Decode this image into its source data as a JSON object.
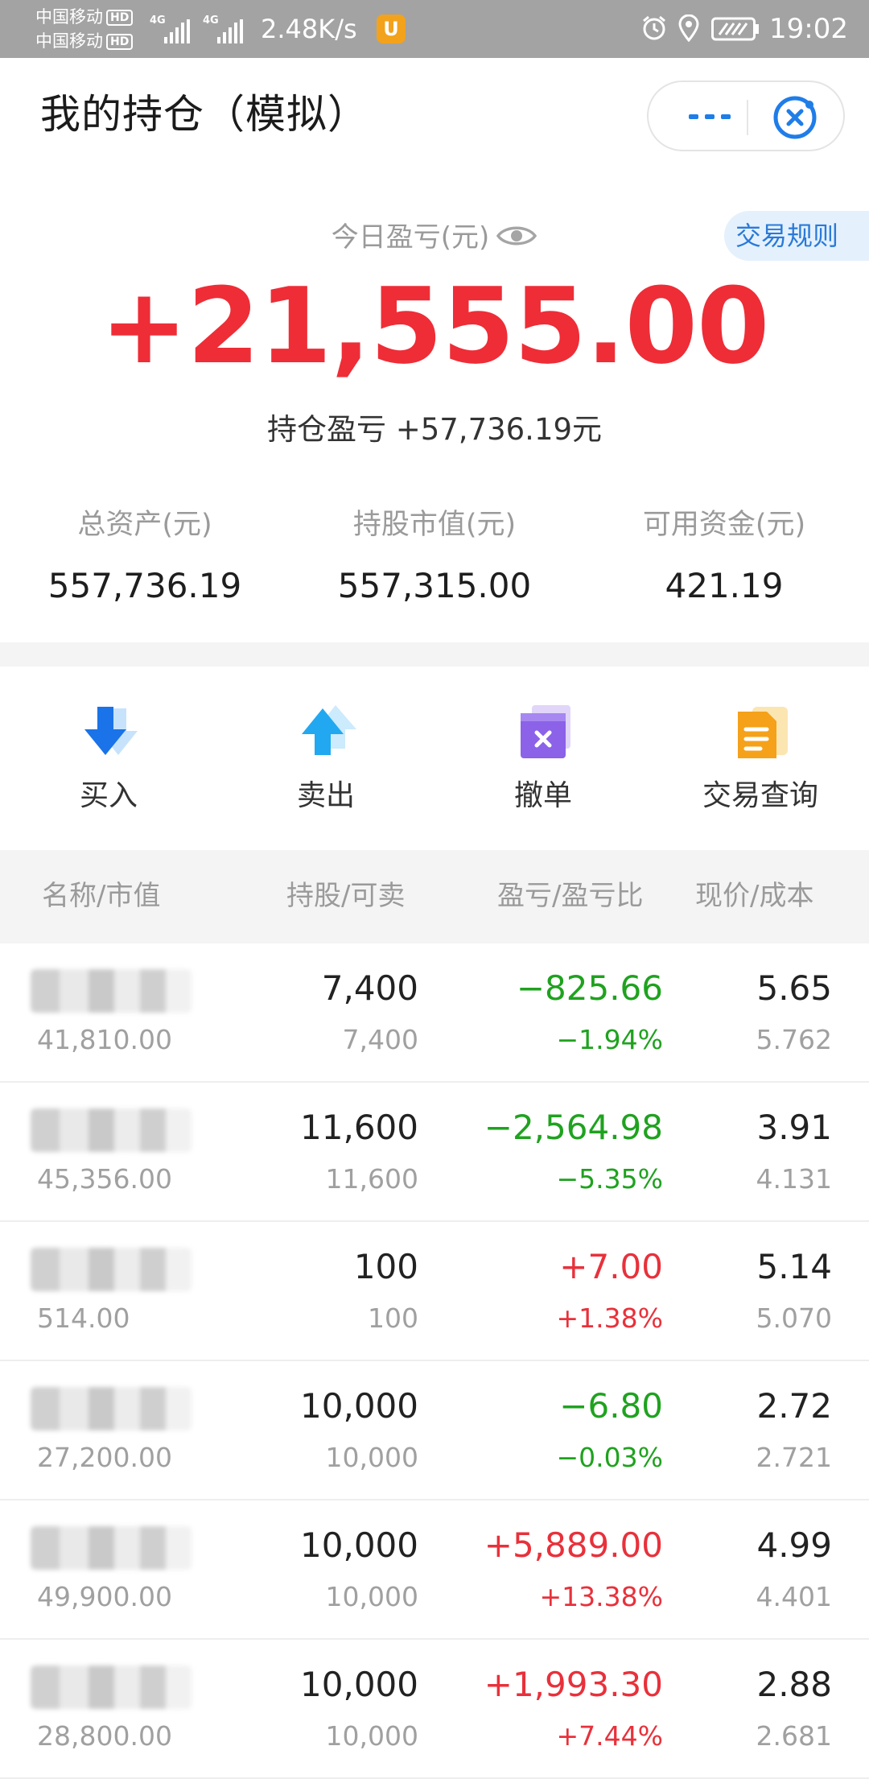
{
  "status_bar": {
    "carrier1": "中国移动",
    "carrier2": "中国移动",
    "hd": "HD",
    "net1": "4G",
    "net2": "4G",
    "speed": "2.48K/s",
    "app_badge": "U",
    "time": "19:02"
  },
  "header": {
    "title": "我的持仓（模拟）"
  },
  "summary": {
    "rules_label": "交易规则",
    "today_label": "今日盈亏(元)",
    "today_value": "+21,555.00",
    "hold_label": "持仓盈亏",
    "hold_value": "+57,736.19元",
    "assets": [
      {
        "label": "总资产(元)",
        "value": "557,736.19"
      },
      {
        "label": "持股市值(元)",
        "value": "557,315.00"
      },
      {
        "label": "可用资金(元)",
        "value": "421.19"
      }
    ]
  },
  "actions": [
    {
      "label": "买入",
      "icon": "buy-arrow-down-icon",
      "color": "#1a73e8"
    },
    {
      "label": "卖出",
      "icon": "sell-arrow-up-icon",
      "color": "#22a8f0"
    },
    {
      "label": "撤单",
      "icon": "cancel-order-icon",
      "color": "#8b62e8"
    },
    {
      "label": "交易查询",
      "icon": "trade-query-icon",
      "color": "#f5a11a"
    }
  ],
  "table": {
    "headers": [
      "名称/市值",
      "持股/可卖",
      "盈亏/盈亏比",
      "现价/成本"
    ],
    "rows": [
      {
        "market_value": "41,810.00",
        "qty": "7,400",
        "avail": "7,400",
        "pl": "−825.66",
        "pl_pct": "−1.94%",
        "price": "5.65",
        "cost": "5.762",
        "trend": "neg"
      },
      {
        "market_value": "45,356.00",
        "qty": "11,600",
        "avail": "11,600",
        "pl": "−2,564.98",
        "pl_pct": "−5.35%",
        "price": "3.91",
        "cost": "4.131",
        "trend": "neg"
      },
      {
        "market_value": "514.00",
        "qty": "100",
        "avail": "100",
        "pl": "+7.00",
        "pl_pct": "+1.38%",
        "price": "5.14",
        "cost": "5.070",
        "trend": "pos"
      },
      {
        "market_value": "27,200.00",
        "qty": "10,000",
        "avail": "10,000",
        "pl": "−6.80",
        "pl_pct": "−0.03%",
        "price": "2.72",
        "cost": "2.721",
        "trend": "neg"
      },
      {
        "market_value": "49,900.00",
        "qty": "10,000",
        "avail": "10,000",
        "pl": "+5,889.00",
        "pl_pct": "+13.38%",
        "price": "4.99",
        "cost": "4.401",
        "trend": "pos"
      },
      {
        "market_value": "28,800.00",
        "qty": "10,000",
        "avail": "10,000",
        "pl": "+1,993.30",
        "pl_pct": "+7.44%",
        "price": "2.88",
        "cost": "2.681",
        "trend": "pos"
      }
    ]
  },
  "colors": {
    "profit": "#e8313b",
    "loss": "#1fa21f",
    "accent": "#2a7ad8"
  }
}
